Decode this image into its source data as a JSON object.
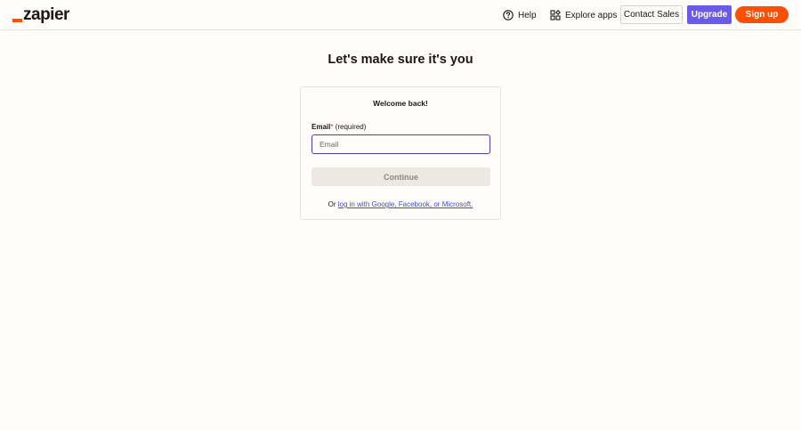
{
  "header": {
    "logo_text": "zapier",
    "help_label": "Help",
    "explore_label": "Explore apps",
    "contact_label": "Contact Sales",
    "upgrade_label": "Upgrade",
    "signup_label": "Sign up"
  },
  "main": {
    "heading": "Let's make sure it's you"
  },
  "card": {
    "title": "Welcome back!",
    "email_label": "Email",
    "required_marker": "*",
    "required_text": "(required)",
    "email_placeholder": "Email",
    "email_value": "",
    "continue_label": "Continue",
    "alt_prefix": "Or ",
    "alt_link": "log in with Google, Facebook, or Microsoft."
  },
  "colors": {
    "brand_orange": "#ff4f00",
    "upgrade_purple": "#695be8",
    "background": "#fffdf9",
    "link_blue": "#3d4cd8"
  },
  "icons": {
    "help": "help-circle-icon",
    "explore": "apps-grid-icon"
  }
}
